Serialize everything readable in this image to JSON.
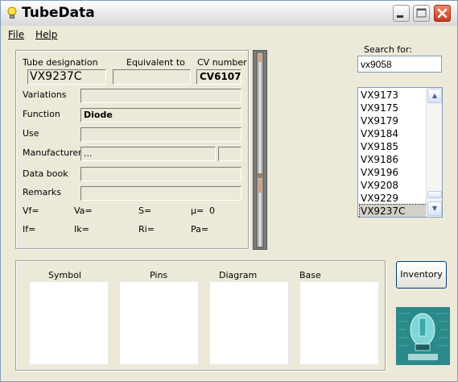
{
  "window": {
    "title": "TubeData"
  },
  "menu": [
    {
      "label": "File"
    },
    {
      "label": "Help"
    }
  ],
  "fields": {
    "tube_designation_label": "Tube designation",
    "tube_designation_value": "VX9237C",
    "equivalent_label": "Equivalent to",
    "equivalent_value": "",
    "cv_label": "CV number",
    "cv_value": "CV6107",
    "variations_label": "Variations",
    "variations_value": "",
    "function_label": "Function",
    "function_value": "Diode",
    "use_label": "Use",
    "use_value": "",
    "manufacturer_label": "Manufacturer",
    "manufacturer_value": "...",
    "manufacturer_code_value": "",
    "databook_label": "Data book",
    "databook_value": "",
    "remarks_label": "Remarks",
    "remarks_value": ""
  },
  "params": {
    "vf": "Vf=",
    "va": "Va=",
    "s": "S=",
    "mu": "µ=",
    "mu_value": "0",
    "if": "If=",
    "ik": "Ik=",
    "ri": "Ri=",
    "pa": "Pa="
  },
  "search": {
    "label": "Search for:",
    "value": "vx9058"
  },
  "list": {
    "items": [
      "VX9173",
      "VX9175",
      "VX9179",
      "VX9184",
      "VX9185",
      "VX9186",
      "VX9196",
      "VX9208",
      "VX9229",
      "VX9237C"
    ],
    "selected": "VX9237C"
  },
  "panels": {
    "symbol": "Symbol",
    "pins": "Pins",
    "diagram": "Diagram",
    "base": "Base"
  },
  "buttons": {
    "inventory": "Inventory"
  },
  "colors": {
    "close_button": "#c8381a",
    "logo_bg": "#2a8a8a",
    "list_border": "#7f9db9"
  }
}
